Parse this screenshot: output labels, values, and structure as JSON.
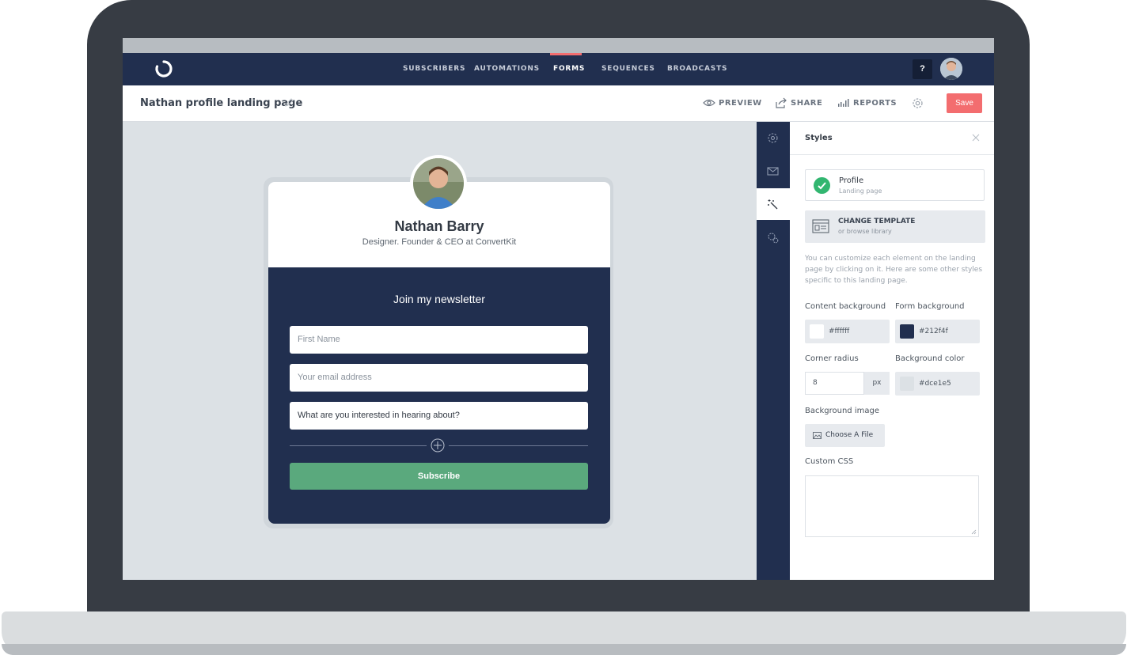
{
  "nav": {
    "items": [
      {
        "label": "SUBSCRIBERS",
        "active": false
      },
      {
        "label": "AUTOMATIONS",
        "active": false
      },
      {
        "label": "FORMS",
        "active": true
      },
      {
        "label": "SEQUENCES",
        "active": false
      },
      {
        "label": "BROADCASTS",
        "active": false
      }
    ],
    "help_label": "?"
  },
  "toolbar": {
    "page_title": "Nathan profile landing page",
    "preview_label": "PREVIEW",
    "share_label": "SHARE",
    "reports_label": "REPORTS",
    "save_label": "Save"
  },
  "form": {
    "name": "Nathan Barry",
    "subtitle": "Designer. Founder & CEO at ConvertKit",
    "heading": "Join my newsletter",
    "fields": [
      {
        "placeholder": "First Name"
      },
      {
        "placeholder": "Your email address"
      },
      {
        "value": "What are you interested in hearing about?"
      }
    ],
    "subscribe_label": "Subscribe"
  },
  "rail": {
    "icons": [
      "settings-icon",
      "mail-icon",
      "magic-wand-icon",
      "advanced-settings-icon"
    ],
    "active_index": 2
  },
  "styles_panel": {
    "title": "Styles",
    "template": {
      "name": "Profile",
      "type": "Landing page"
    },
    "change_template": {
      "title": "CHANGE TEMPLATE",
      "subtitle": "or browse library"
    },
    "description": "You can customize each element on the landing page by clicking on it. Here are some other styles specific to this landing page.",
    "content_background": {
      "label": "Content background",
      "value": "#ffffff"
    },
    "form_background": {
      "label": "Form background",
      "value": "#212f4f"
    },
    "corner_radius": {
      "label": "Corner radius",
      "value": "8",
      "unit": "px"
    },
    "background_color": {
      "label": "Background color",
      "value": "#dce1e5"
    },
    "background_image": {
      "label": "Background image",
      "button": "Choose A File"
    },
    "custom_css": {
      "label": "Custom CSS",
      "value": ""
    }
  },
  "colors": {
    "nav_bg": "#212f4f",
    "accent": "#f36d6f",
    "subscribe": "#5aa97d",
    "success": "#32b670"
  }
}
